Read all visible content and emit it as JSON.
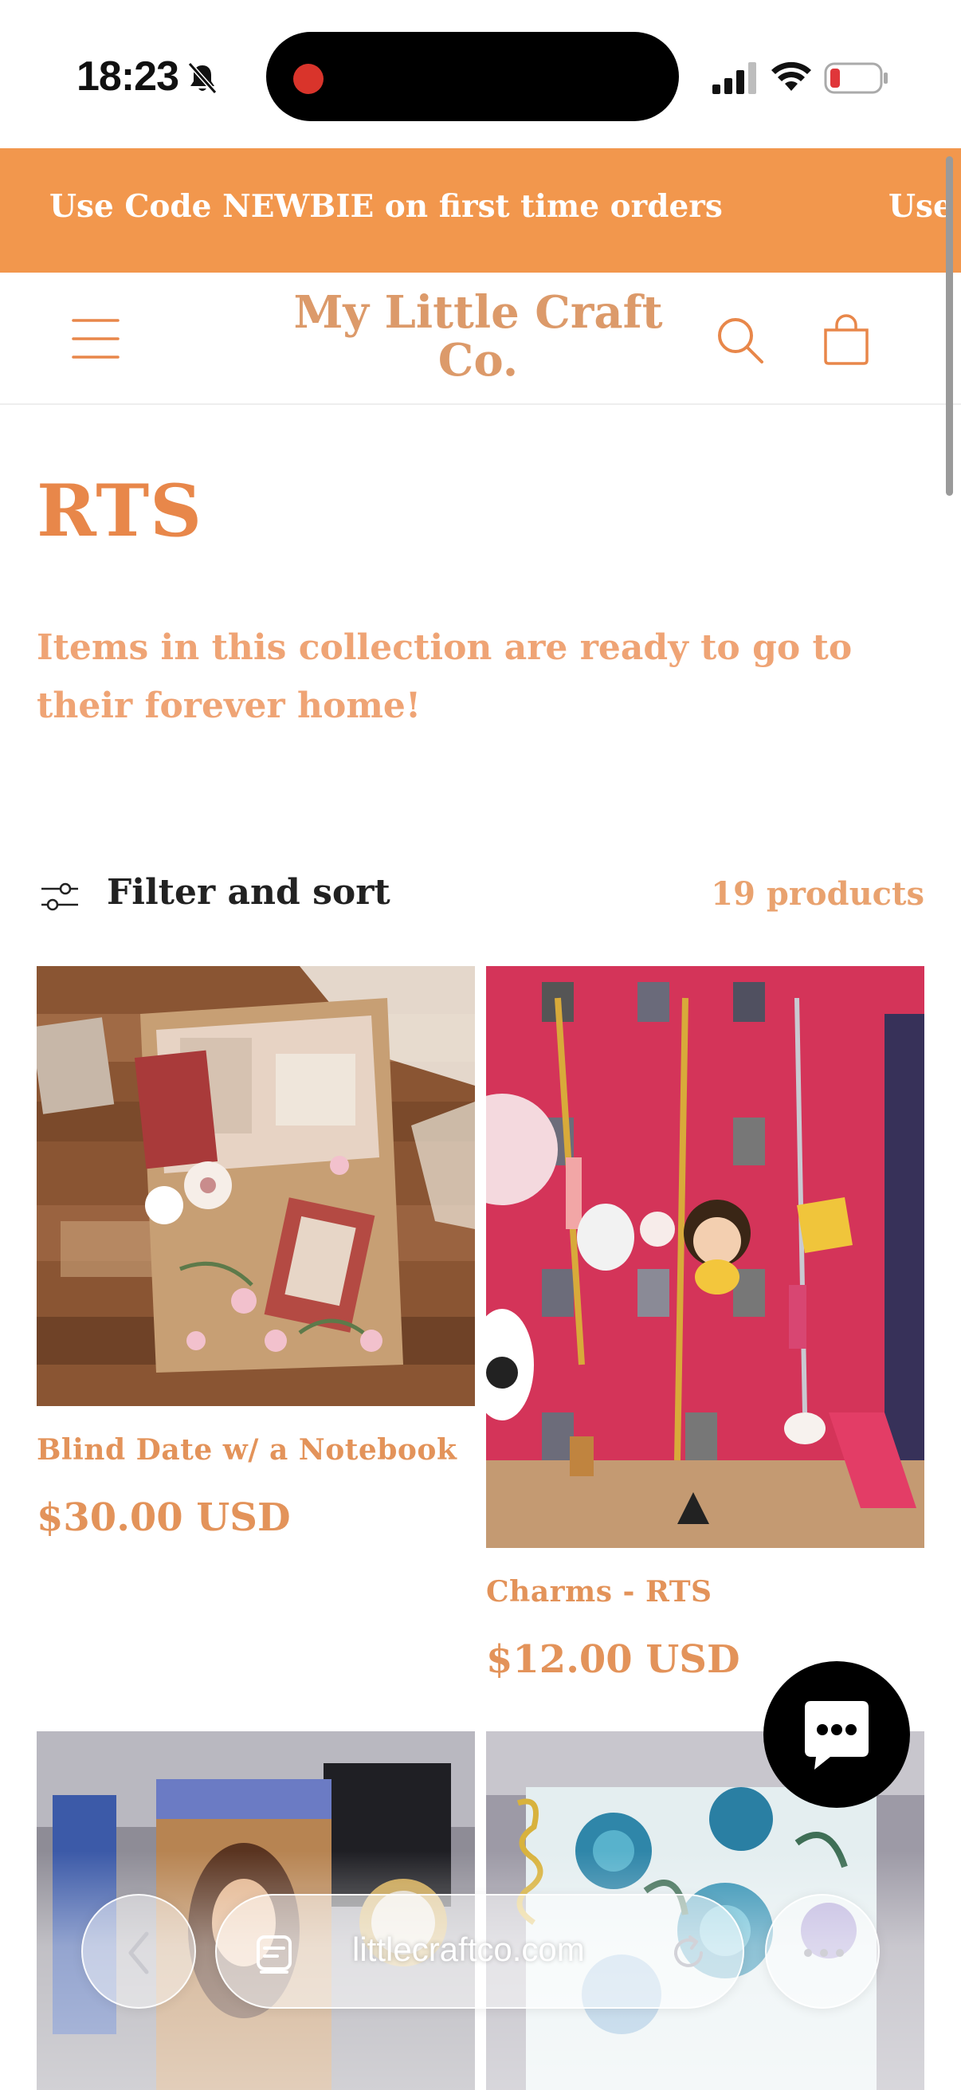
{
  "status_bar": {
    "time": "18:23"
  },
  "announcement": {
    "text": "Use Code NEWBIE on first time orders",
    "text_repeat": "Use C"
  },
  "header": {
    "site_title": "My Little Craft Co."
  },
  "collection": {
    "title": "RTS",
    "description": "Items in this collection are ready to go to their forever home!"
  },
  "filter": {
    "label": "Filter and sort",
    "count": "19 products"
  },
  "products": [
    {
      "title": "Blind Date w/ a Notebook",
      "price": "$30.00 USD"
    },
    {
      "title": "Charms - RTS",
      "price": "$12.00 USD"
    }
  ],
  "browser": {
    "url": "littlecraftco.com"
  },
  "colors": {
    "announcement_bg": "#f2974d",
    "brand_orange": "#e8874a",
    "brand_light": "#efa475"
  },
  "icons": [
    "bell-slash-icon",
    "signal-icon",
    "wifi-icon",
    "battery-icon",
    "menu-icon",
    "search-icon",
    "cart-icon",
    "filter-icon",
    "chat-icon",
    "back-icon",
    "tabs-icon",
    "reload-icon",
    "more-icon"
  ]
}
